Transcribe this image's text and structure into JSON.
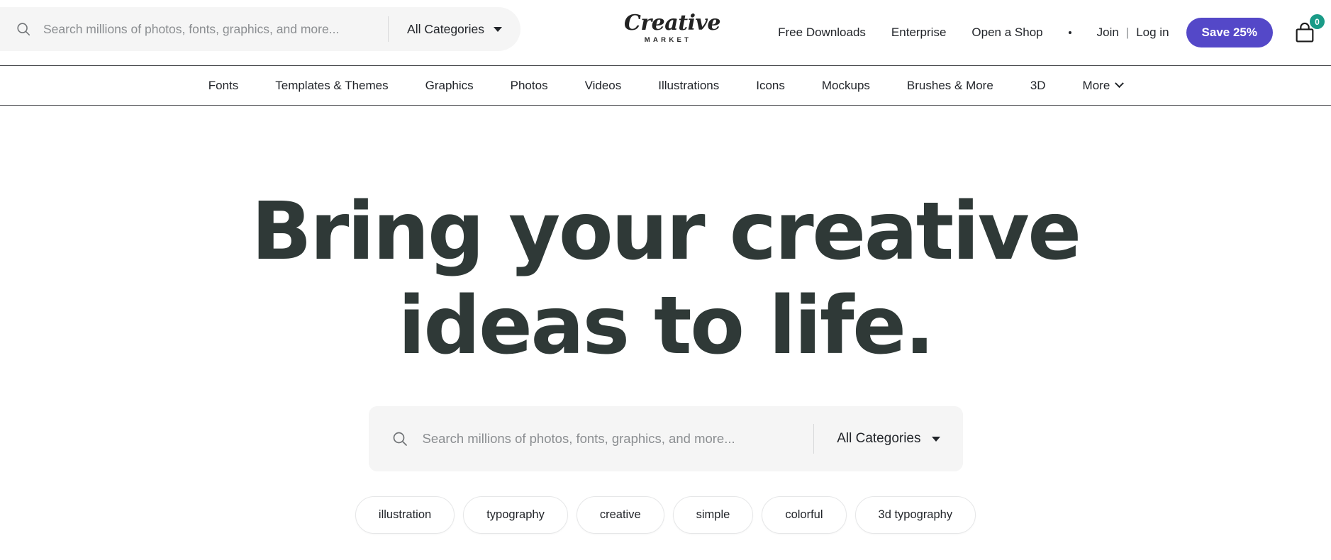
{
  "header": {
    "search": {
      "placeholder": "Search millions of photos, fonts, graphics, and more...",
      "value": "",
      "category_label": "All Categories",
      "search_icon": "search-icon",
      "caret_icon": "chevron-down-icon"
    },
    "logo": {
      "script": "Creative",
      "sub": "MARKET"
    },
    "links": [
      {
        "label": "Free Downloads"
      },
      {
        "label": "Enterprise"
      },
      {
        "label": "Open a Shop"
      }
    ],
    "separator_dot": "•",
    "auth": {
      "join": "Join",
      "pipe": "|",
      "login": "Log in"
    },
    "save_button": {
      "label": "Save 25%",
      "color": "#5448c8"
    },
    "cart": {
      "icon": "shopping-bag-icon",
      "count": "0",
      "badge_color": "#1a9b87"
    }
  },
  "category_nav": {
    "items": [
      {
        "label": "Fonts"
      },
      {
        "label": "Templates & Themes"
      },
      {
        "label": "Graphics"
      },
      {
        "label": "Photos"
      },
      {
        "label": "Videos"
      },
      {
        "label": "Illustrations"
      },
      {
        "label": "Icons"
      },
      {
        "label": "Mockups"
      },
      {
        "label": "Brushes & More"
      },
      {
        "label": "3D"
      },
      {
        "label": "More"
      }
    ],
    "more_caret_icon": "chevron-down-icon"
  },
  "hero": {
    "title_line1": "Bring your creative",
    "title_line2": "ideas to life.",
    "title_color": "#2f3937",
    "search": {
      "placeholder": "Search millions of photos, fonts, graphics, and more...",
      "value": "",
      "category_label": "All Categories",
      "search_icon": "search-icon",
      "caret_icon": "chevron-down-icon"
    },
    "tags": [
      {
        "label": "illustration"
      },
      {
        "label": "typography"
      },
      {
        "label": "creative"
      },
      {
        "label": "simple"
      },
      {
        "label": "colorful"
      },
      {
        "label": "3d typography"
      }
    ]
  }
}
